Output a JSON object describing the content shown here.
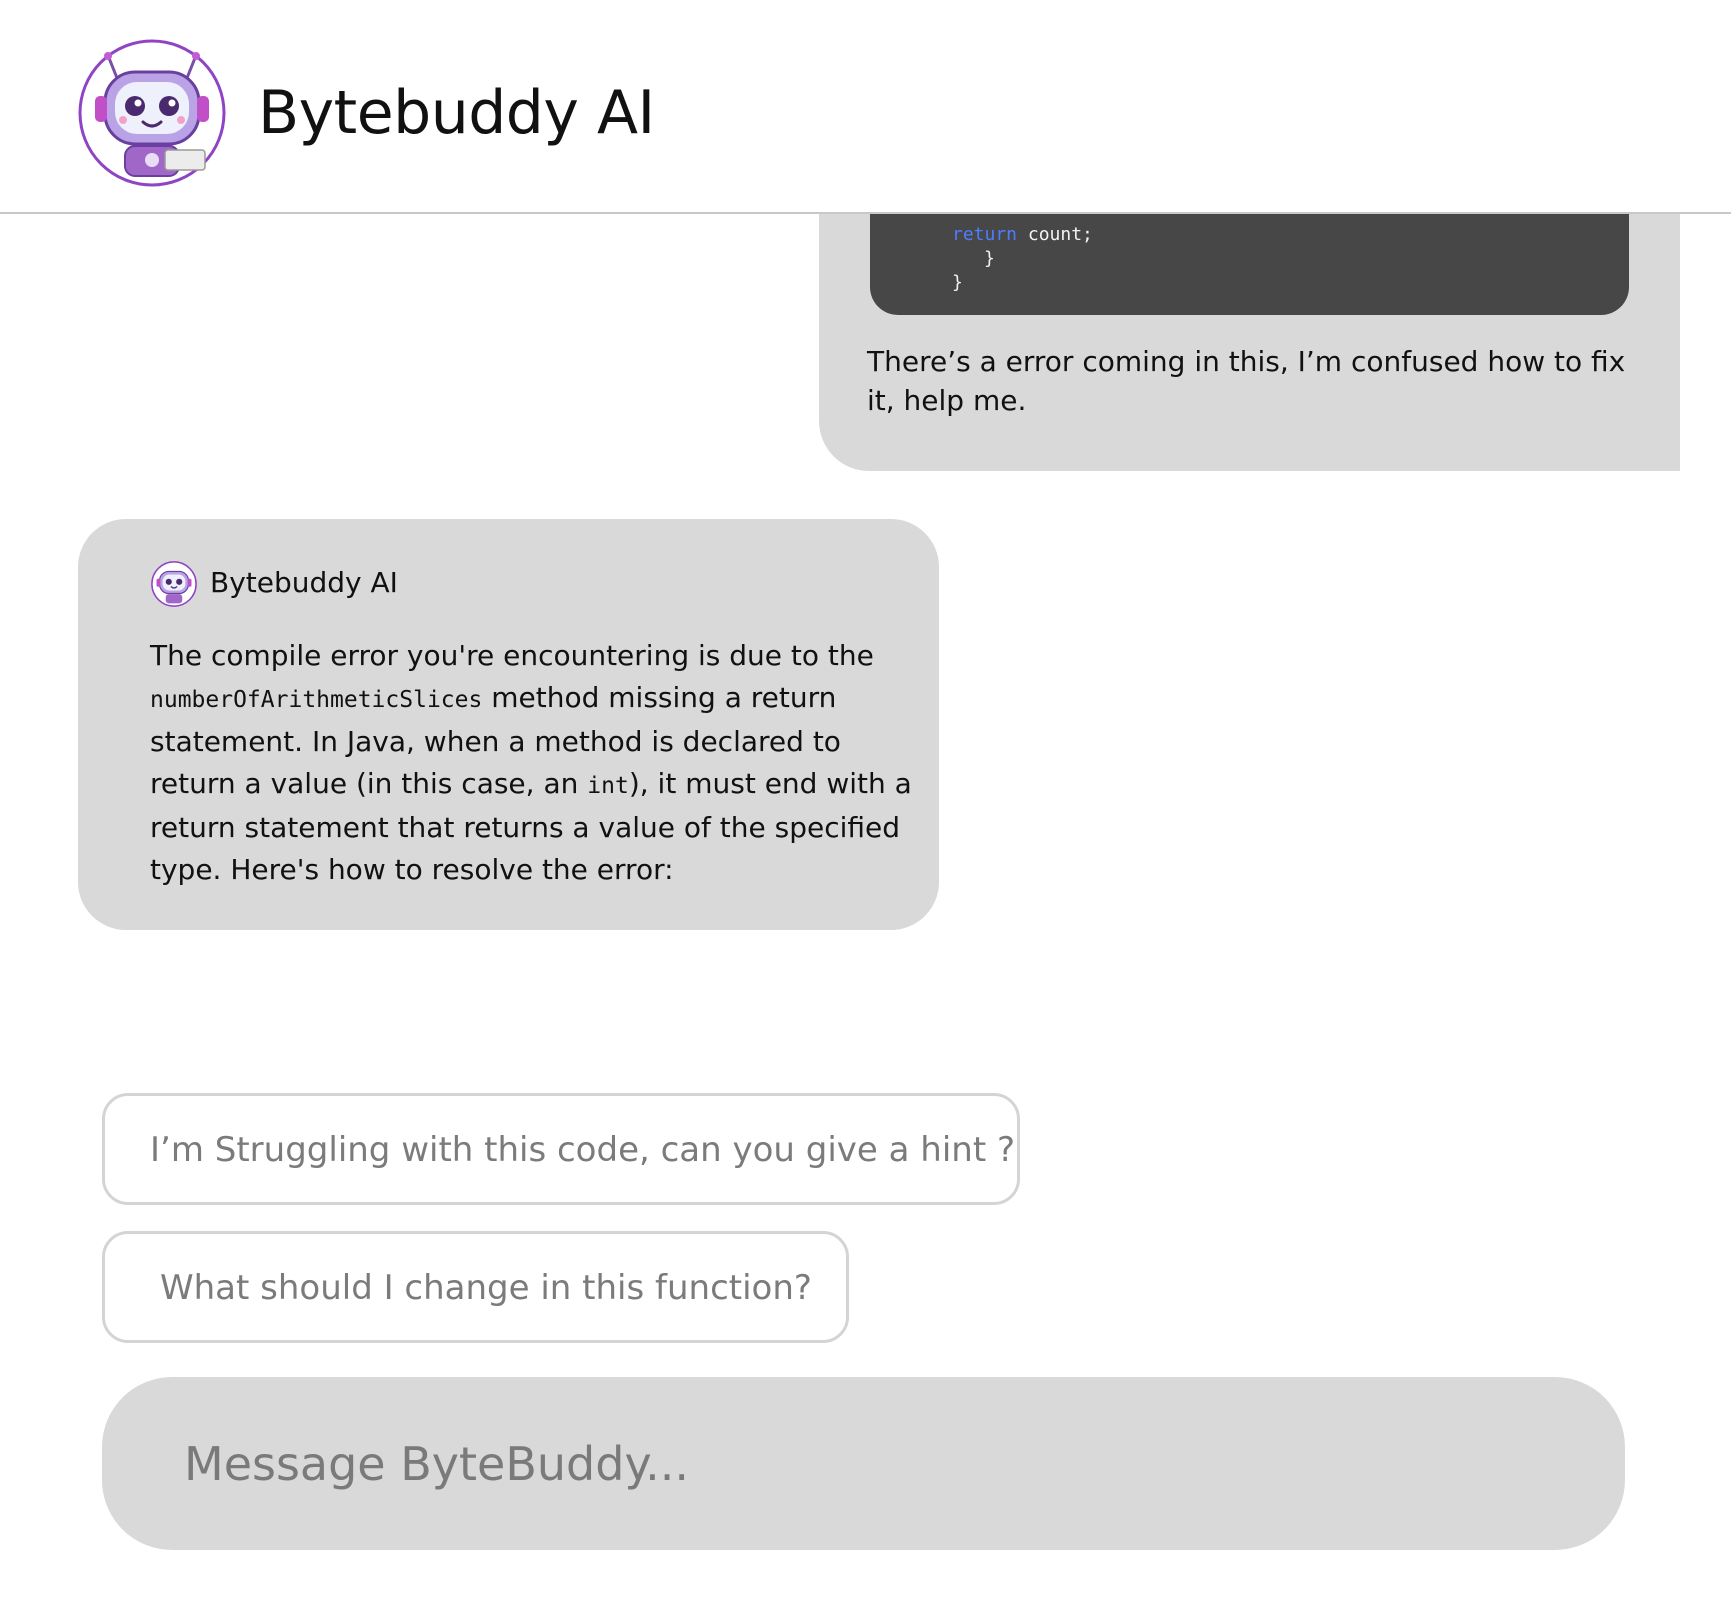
{
  "header": {
    "title": "Bytebuddy AI",
    "avatar_icon": "robot-avatar-icon"
  },
  "conversation": {
    "user_message": {
      "code_lines": [
        {
          "indent": "",
          "keyword": "return",
          "rest": " count;"
        },
        {
          "indent": "   ",
          "keyword": "",
          "rest": "}"
        },
        {
          "indent": "",
          "keyword": "",
          "rest": "}"
        }
      ],
      "text": "There’s a error coming in this, I’m confused how to fix it, help me."
    },
    "bot_message": {
      "sender": "Bytebuddy AI",
      "text_parts": {
        "p1": "The compile error you're encountering is due to the ",
        "code1": "numberOfArithmeticSlices",
        "p2": " method missing a return statement. In Java, when a method is declared to return a value (in this case, an ",
        "code2": "int",
        "p3": "), it must end with a return statement that returns a value of the specified type. Here's how to resolve the error:"
      }
    }
  },
  "suggestions": [
    "I’m Struggling with this code, can you give a hint ?",
    "What should I change in this function?"
  ],
  "composer": {
    "placeholder": "Message ByteBuddy..."
  },
  "colors": {
    "accent_purple": "#8e44c4",
    "bubble_gray": "#d9d9d9",
    "code_bg": "#474747",
    "keyword_blue": "#4d7cff"
  }
}
